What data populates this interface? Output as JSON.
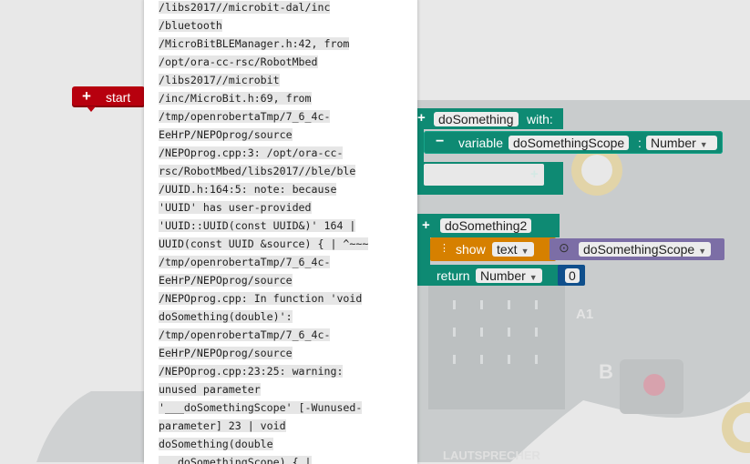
{
  "start_block": {
    "plus": "+",
    "label": "start"
  },
  "log": {
    "lines": [
      "/libs2017//microbit-dal/inc",
      "/bluetooth",
      "/MicroBitBLEManager.h:42, from",
      "/opt/ora-cc-rsc/RobotMbed",
      "/libs2017//microbit",
      "/inc/MicroBit.h:69, from",
      "/tmp/openrobertaTmp/7_6_4c-",
      "EeHrP/NEPOprog/source",
      "/NEPOprog.cpp:3: /opt/ora-cc-",
      "rsc/RobotMbed/libs2017//ble/ble",
      "/UUID.h:164:5: note: because",
      "'UUID' has user-provided",
      "'UUID::UUID(const UUID&)' 164 |",
      "UUID(const UUID &source) { | ^~~~",
      "/tmp/openrobertaTmp/7_6_4c-",
      "EeHrP/NEPOprog/source",
      "/NEPOprog.cpp: In function 'void",
      "doSomething(double)':",
      "/tmp/openrobertaTmp/7_6_4c-",
      "EeHrP/NEPOprog/source",
      "/NEPOprog.cpp:23:25: warning:",
      "unused parameter",
      "'___doSomethingScope' [-Wunused-",
      "parameter] 23 | void",
      "doSomething(double",
      "___doSomethingScope) { |"
    ]
  },
  "proc1": {
    "plus": "+",
    "name": "doSomething",
    "with_label": "with:",
    "minus": "−",
    "variable_label": "variable",
    "var_name": "doSomethingScope",
    "colon": ":",
    "var_type": "Number",
    "add_plus": "+"
  },
  "proc2": {
    "plus": "+",
    "name": "doSomething2",
    "show_label": "show",
    "show_type": "text",
    "param_name": "doSomethingScope",
    "return_label": "return",
    "return_type": "Number",
    "return_value": "0"
  },
  "board": {
    "pin_label": "A1",
    "button_label": "B",
    "speaker_label": "LAUTSPRECHER"
  },
  "colors": {
    "start": "#b7000e",
    "procedure": "#0e8a73",
    "show_block": "#d68000",
    "variable_block": "#7c6ea6",
    "number_block": "#0f4f8c"
  }
}
